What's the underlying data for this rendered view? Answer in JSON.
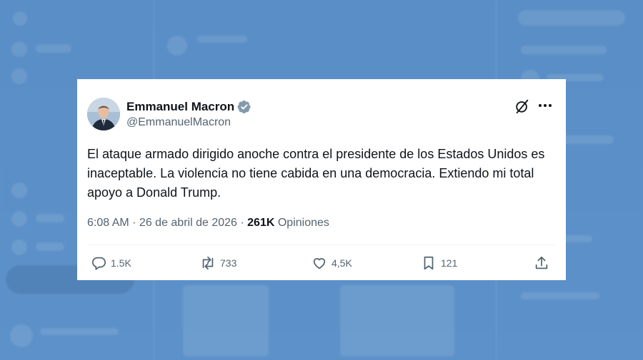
{
  "tweet": {
    "author_name": "Emmanuel Macron",
    "author_handle": "@EmmanuelMacron",
    "verified": true,
    "text": "El ataque armado dirigido anoche contra el presidente de los Estados Unidos es inaceptable. La violencia no tiene cabida en una democracia. Extiendo mi total apoyo a Donald Trump.",
    "time": "6:08 AM",
    "separator": " · ",
    "date": "26 de abril de 2026",
    "views_count": "261K",
    "views_label": "Opiniones",
    "actions": {
      "replies": "1.5K",
      "reposts": "733",
      "likes": "4,5K",
      "bookmarks": "121"
    }
  },
  "colors": {
    "background": "#5b8fc7",
    "verified": "#829aab",
    "text": "#0f1419",
    "secondary": "#536471"
  },
  "icons": [
    "grok-icon",
    "more-icon",
    "reply-icon",
    "repost-icon",
    "like-icon",
    "bookmark-icon",
    "share-icon"
  ]
}
